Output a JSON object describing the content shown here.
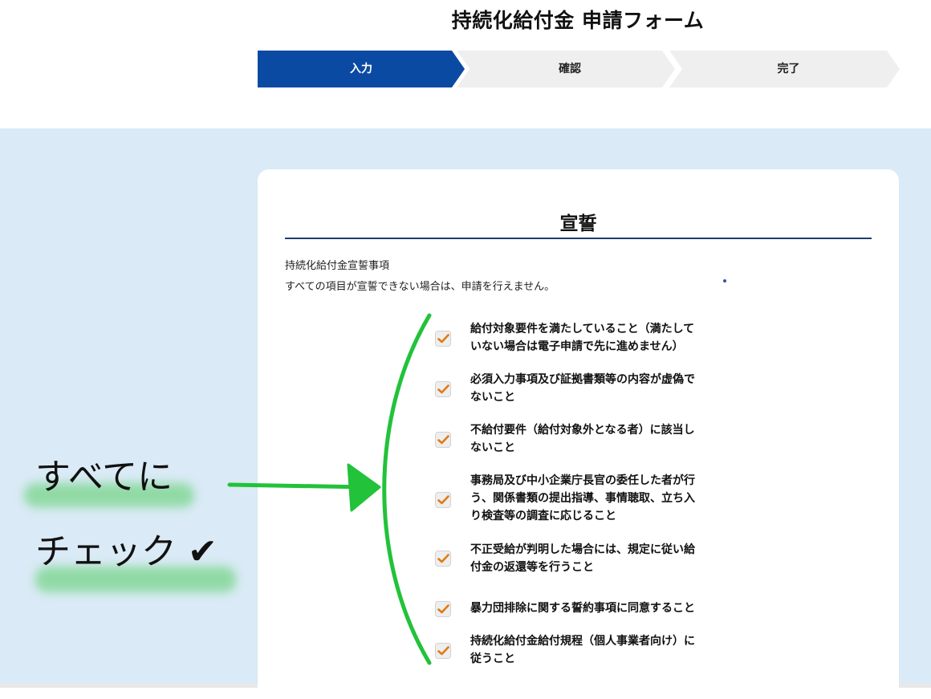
{
  "header": {
    "title": "持続化給付金 申請フォーム",
    "steps": [
      {
        "label": "入力",
        "active": true
      },
      {
        "label": "確認",
        "active": false
      },
      {
        "label": "完了",
        "active": false
      }
    ]
  },
  "card": {
    "title": "宣誓",
    "lead_1": "持続化給付金宣誓事項",
    "lead_2": "すべての項目が宣誓できない場合は、申請を行えません。",
    "items": [
      {
        "checked": true,
        "lines": [
          "給付対象要件を満たしていること（満たして",
          "いない場合は電子申請で先に進めません）"
        ]
      },
      {
        "checked": true,
        "lines": [
          "必須入力事項及び証拠書類等の内容が虚偽で",
          "ないこと"
        ]
      },
      {
        "checked": true,
        "lines": [
          "不給付要件（給付対象外となる者）に該当し",
          "ないこと"
        ]
      },
      {
        "checked": true,
        "lines": [
          "事務局及び中小企業庁長官の委任した者が行",
          "う、関係書類の提出指導、事情聴取、立ち入",
          "り検査等の調査に応じること"
        ]
      },
      {
        "checked": true,
        "lines": [
          "不正受給が判明した場合には、規定に従い給",
          "付金の返還等を行うこと"
        ]
      },
      {
        "checked": true,
        "lines": [
          "暴力団排除に関する誓約事項に同意すること"
        ]
      },
      {
        "checked": true,
        "lines": [
          "持続化給付金給付規程（個人事業者向け）に",
          "従うこと"
        ]
      }
    ]
  },
  "annotation": {
    "line_1": "すべてに",
    "line_2": "チェック ✔",
    "color": "#22c23a"
  },
  "colors": {
    "step_active": "#0b4aa3",
    "step_inactive": "#efefef",
    "background": "#daeaf6",
    "checkmark": "#e07b14"
  }
}
